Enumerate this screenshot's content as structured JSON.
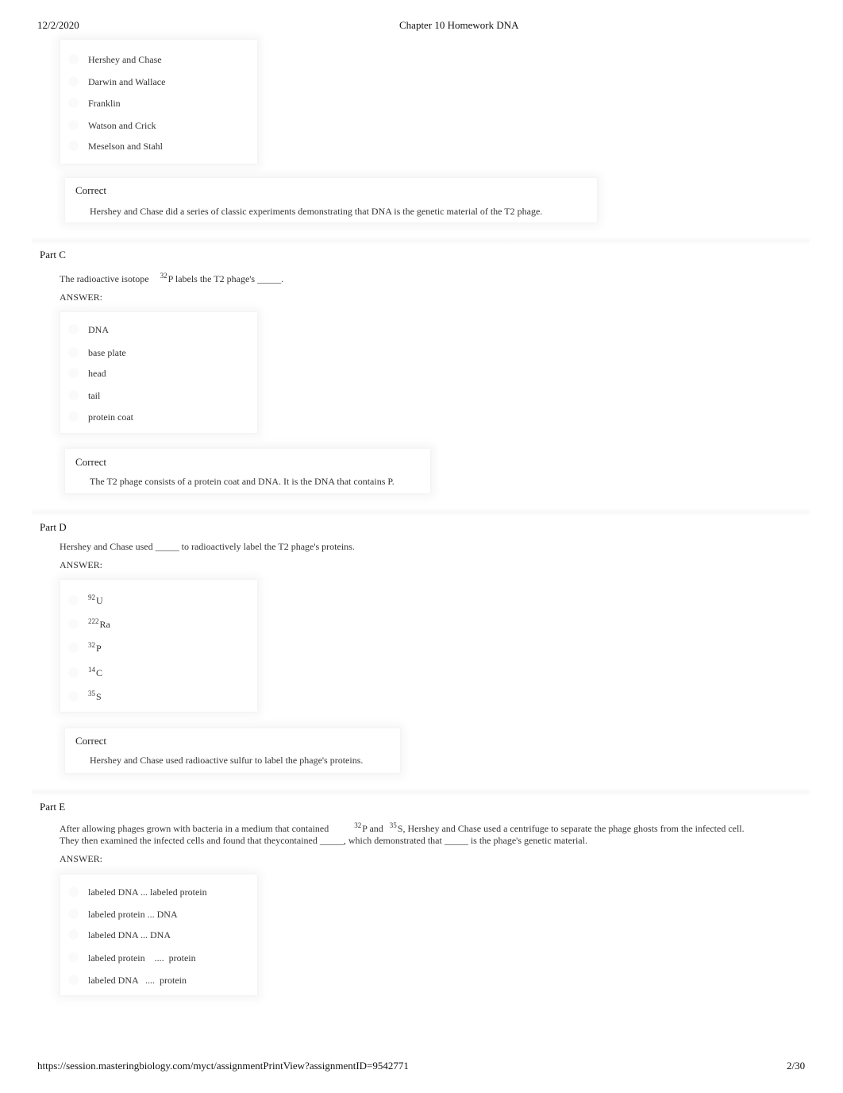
{
  "header": {
    "date": "12/2/2020",
    "title": "Chapter 10 Homework DNA"
  },
  "footer": {
    "url": "https://session.masteringbiology.com/myct/assignmentPrintView?assignmentID=9542771",
    "page": "2/30"
  },
  "part_b": {
    "options": [
      "Hershey and Chase",
      "Darwin and Wallace",
      "Franklin",
      "Watson and Crick",
      "Meselson and Stahl"
    ],
    "feedback_title": "Correct",
    "feedback_text": "Hershey and Chase did a series of classic experiments demonstrating that DNA is the genetic material of the T2 phage."
  },
  "part_c": {
    "title": "Part C",
    "question_pre": "The radioactive isotope",
    "question_sup": "32",
    "question_post": "P labels the T2 phage's _____.",
    "answer_label": "ANSWER:",
    "options": [
      "DNA",
      "base plate",
      "head",
      "tail",
      "protein coat"
    ],
    "feedback_title": "Correct",
    "feedback_text": "The T2 phage consists of a protein coat and DNA. It is the DNA that contains P."
  },
  "part_d": {
    "title": "Part D",
    "question": "Hershey and Chase used _____ to radioactively label the T2 phage's proteins.",
    "answer_label": "ANSWER:",
    "options": [
      {
        "sup": "92",
        "symbol": "U"
      },
      {
        "sup": "222",
        "symbol": "Ra"
      },
      {
        "sup": "32",
        "symbol": "P"
      },
      {
        "sup": "14",
        "symbol": "C"
      },
      {
        "sup": "35",
        "symbol": "S"
      }
    ],
    "feedback_title": "Correct",
    "feedback_text": "Hershey and Chase used radioactive sulfur to label the phage's proteins."
  },
  "part_e": {
    "title": "Part E",
    "question_line1_pre": "After allowing phages grown with bacteria in a medium that contained",
    "question_sup1": "32",
    "question_mid": "P and",
    "question_sup2": "35",
    "question_line1_post": "S, Hershey and Chase used a centrifuge to separate the phage ghosts from the infected cell.",
    "question_line2": "They then examined the infected cells and found that theycontained _____, which demonstrated that _____ is the phage's genetic material.",
    "answer_label": "ANSWER:",
    "options": [
      "labeled DNA ... labeled protein",
      "labeled protein ... DNA",
      "labeled DNA ... DNA",
      "labeled protein    ....  protein",
      "labeled DNA   ....  protein"
    ]
  }
}
